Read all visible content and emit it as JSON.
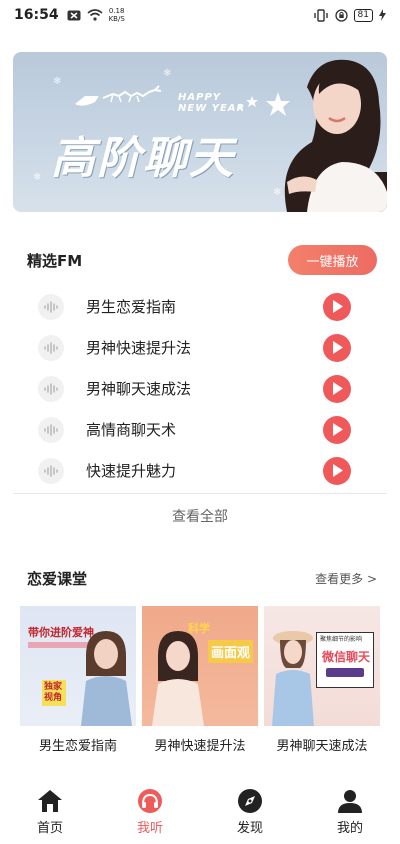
{
  "status_bar": {
    "time": "16:54",
    "net_speed_value": "0.18",
    "net_speed_unit": "KB/S",
    "battery": "81"
  },
  "banner": {
    "title": "高阶聊天",
    "greeting_line1": "HAPPY",
    "greeting_line2": "NEW YEAR"
  },
  "fm": {
    "title": "精选FM",
    "play_all_label": "一键播放",
    "items": [
      {
        "label": "男生恋爱指南"
      },
      {
        "label": "男神快速提升法"
      },
      {
        "label": "男神聊天速成法"
      },
      {
        "label": "高情商聊天术"
      },
      {
        "label": "快速提升魅力"
      }
    ],
    "view_all_label": "查看全部"
  },
  "courses": {
    "title": "恋爱课堂",
    "more_label": "查看更多 >",
    "items": [
      {
        "caption": "男生恋爱指南",
        "poster_title": "带你进阶爱神",
        "poster_sub": "独家视角"
      },
      {
        "caption": "男神快速提升法",
        "poster_title": "画面观",
        "poster_sub": "科学"
      },
      {
        "caption": "男神聊天速成法",
        "poster_title": "微信聊天",
        "poster_sub": "聚焦细节的影响"
      }
    ]
  },
  "nav": {
    "items": [
      {
        "label": "首页",
        "icon": "home-icon"
      },
      {
        "label": "我听",
        "icon": "headphones-icon"
      },
      {
        "label": "发现",
        "icon": "compass-icon"
      },
      {
        "label": "我的",
        "icon": "person-icon"
      }
    ]
  },
  "colors": {
    "accent": "#ef5b5b",
    "play_button": "#f0595a"
  }
}
